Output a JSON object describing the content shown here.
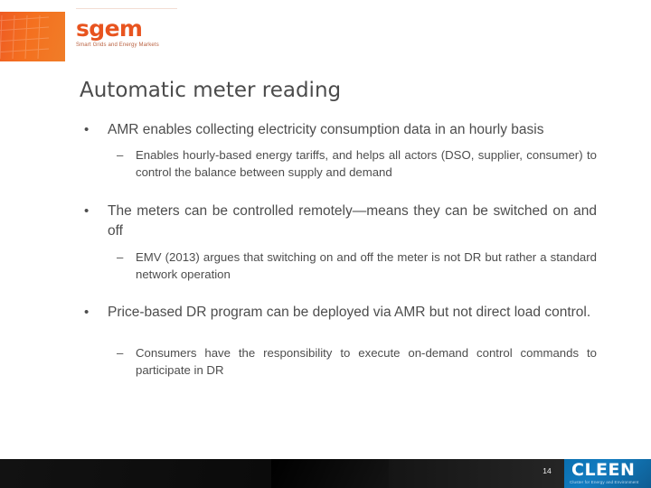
{
  "brand": {
    "logo_word": "sgem",
    "logo_tagline": "Smart Grids and Energy Markets",
    "logo_orange": "#ee5b24"
  },
  "slide": {
    "title": "Automatic meter reading",
    "bullets": [
      {
        "level": 1,
        "marker": "•",
        "text": "AMR enables collecting electricity consumption data in an hourly basis"
      },
      {
        "level": 2,
        "marker": "–",
        "text": "Enables hourly-based energy tariffs, and helps all actors (DSO, supplier, consumer) to control the balance between supply and demand"
      },
      {
        "level": 1,
        "marker": "•",
        "text": "The meters can be controlled remotely—means they can be switched on and off"
      },
      {
        "level": 2,
        "marker": "–",
        "text": "EMV (2013) argues that switching on and off the meter is not DR but rather a standard network operation"
      },
      {
        "level": 1,
        "marker": "•",
        "text": "Price-based DR program can be deployed via AMR but not direct load control."
      },
      {
        "level": 2,
        "marker": "–",
        "text": "Consumers have the responsibility to execute on-demand control commands to participate in DR"
      }
    ]
  },
  "footer": {
    "page_number": "14",
    "cleen_word": "CLEEN",
    "cleen_tagline": "Cluster for Energy and Environment",
    "cleen_blue": "#0f6fae",
    "bar_color": "#0d0d0d"
  }
}
